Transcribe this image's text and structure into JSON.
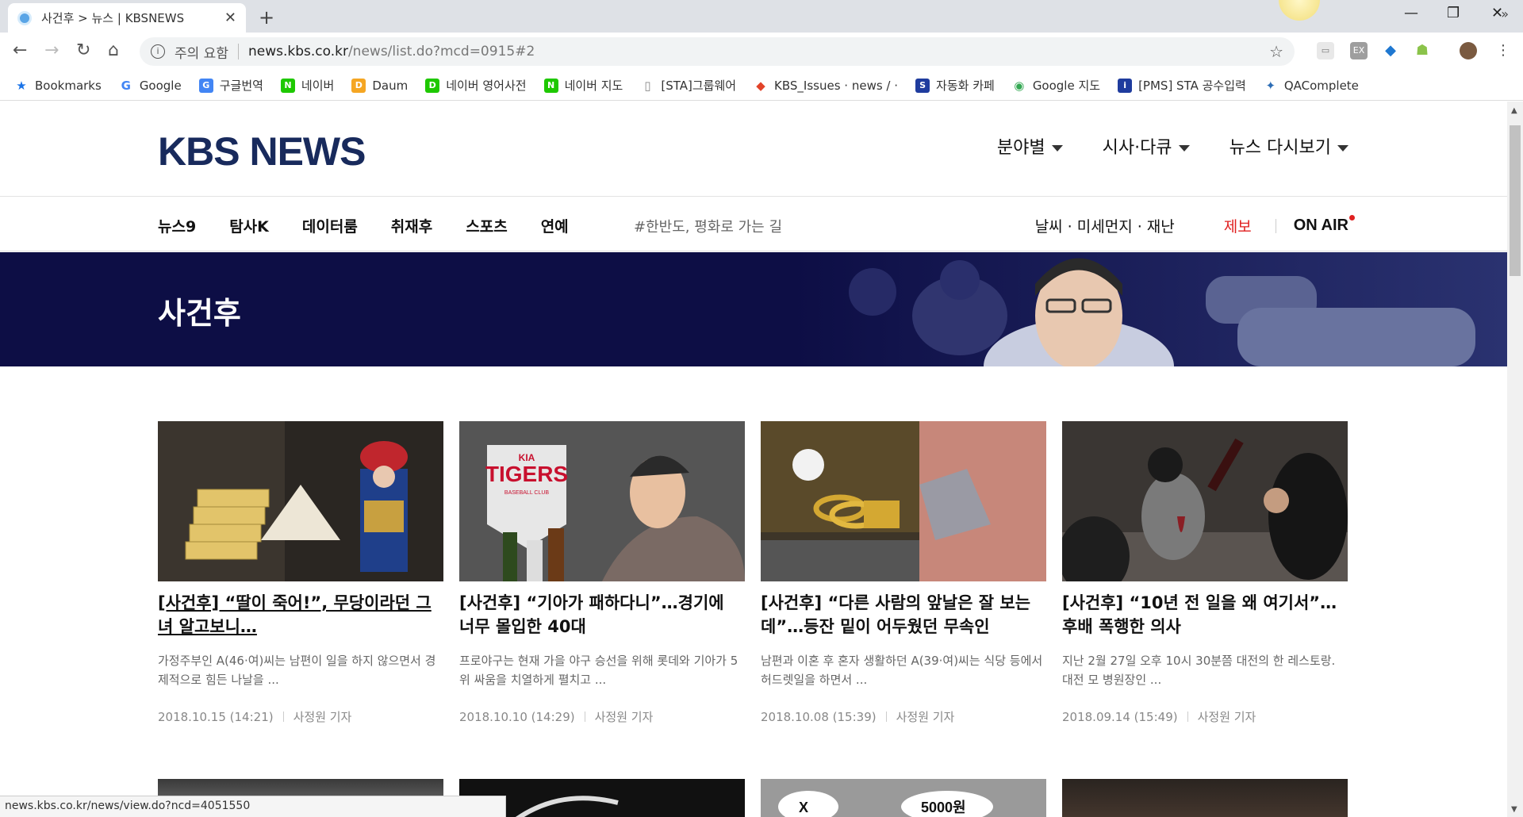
{
  "browser": {
    "tab_title": "사건후 > 뉴스 | KBSNEWS",
    "url_warning": "주의 요함",
    "url_domain": "news.kbs.co.kr",
    "url_path": "/news/list.do?mcd=0915#2",
    "bookmarks": [
      {
        "label": "Bookmarks",
        "icon": "star-icon",
        "color": "#1a73e8"
      },
      {
        "label": "Google",
        "icon": "google-icon",
        "color": "#4285f4"
      },
      {
        "label": "구글번역",
        "icon": "translate-icon",
        "color": "#4285f4"
      },
      {
        "label": "네이버",
        "icon": "naver-icon",
        "color": "#1ec800"
      },
      {
        "label": "Daum",
        "icon": "daum-icon",
        "color": "#f5a623"
      },
      {
        "label": "네이버 영어사전",
        "icon": "dict-icon",
        "color": "#1ec800"
      },
      {
        "label": "네이버 지도",
        "icon": "naver-icon",
        "color": "#1ec800"
      },
      {
        "label": "[STA]그룹웨어",
        "icon": "page-icon",
        "color": "#888888"
      },
      {
        "label": "KBS_Issues · news / ·",
        "icon": "gitlab-icon",
        "color": "#e24329"
      },
      {
        "label": "자동화 카페",
        "icon": "stq-icon",
        "color": "#1f3c9e"
      },
      {
        "label": "Google 지도",
        "icon": "maps-icon",
        "color": "#34a853"
      },
      {
        "label": "[PMS] STA 공수입력",
        "icon": "pms-icon",
        "color": "#1f3c9e"
      },
      {
        "label": "QAComplete",
        "icon": "qa-icon",
        "color": "#2d6db5"
      }
    ],
    "status_url": "news.kbs.co.kr/news/view.do?ncd=4051550"
  },
  "header": {
    "logo": "KBS NEWS",
    "menu": [
      "분야별",
      "시사·다큐",
      "뉴스 다시보기"
    ]
  },
  "subnav": {
    "items": [
      "뉴스9",
      "탐사K",
      "데이터룸",
      "취재후",
      "스포츠",
      "연예"
    ],
    "hashtag": "#한반도, 평화로 가는 길",
    "weather": "날씨 · 미세먼지 · 재난",
    "report": "제보",
    "onair": "ON AIR"
  },
  "banner": {
    "title": "사건후"
  },
  "articles": [
    {
      "title": "[사건후] “딸이 죽어!”, 무당이라던 그녀 알고보니…",
      "summary": "가정주부인 A(46·여)씨는 남편이 일을 하지 않으면서 경제적으로 힘든 나날을 ...",
      "date": "2018.10.15 (14:21)",
      "author": "사정원 기자",
      "theme": "shaman"
    },
    {
      "title": "[사건후] “기아가 패하다니”…경기에 너무 몰입한 40대",
      "summary": "프로야구는 현재 가을 야구 승선을 위해 롯데와 기아가 5위 싸움을 치열하게 펼치고 ...",
      "date": "2018.10.10 (14:29)",
      "author": "사정원 기자",
      "theme": "baseball",
      "thumb_text": [
        "KIA",
        "TIGERS",
        "BASEBALL CLUB"
      ]
    },
    {
      "title": "[사건후] “다른 사람의 앞날은 잘 보는데”…등잔 밑이 어두웠던 무속인",
      "summary": "남편과 이혼 후 혼자 생활하던 A(39·여)씨는 식당 등에서 허드렛일을 하면서 ...",
      "date": "2018.10.08 (15:39)",
      "author": "사정원 기자",
      "theme": "jewelry"
    },
    {
      "title": "[사건후] “10년 전 일을 왜 여기서”…후배 폭행한 의사",
      "summary": "지난 2월 27일 오후 10시 30분쯤 대전의 한 레스토랑. 대전 모 병원장인 ...",
      "date": "2018.09.14 (15:49)",
      "author": "사정원 기자",
      "theme": "restaurant"
    }
  ],
  "second_row_thumb_text": [
    "X",
    "5000원"
  ]
}
